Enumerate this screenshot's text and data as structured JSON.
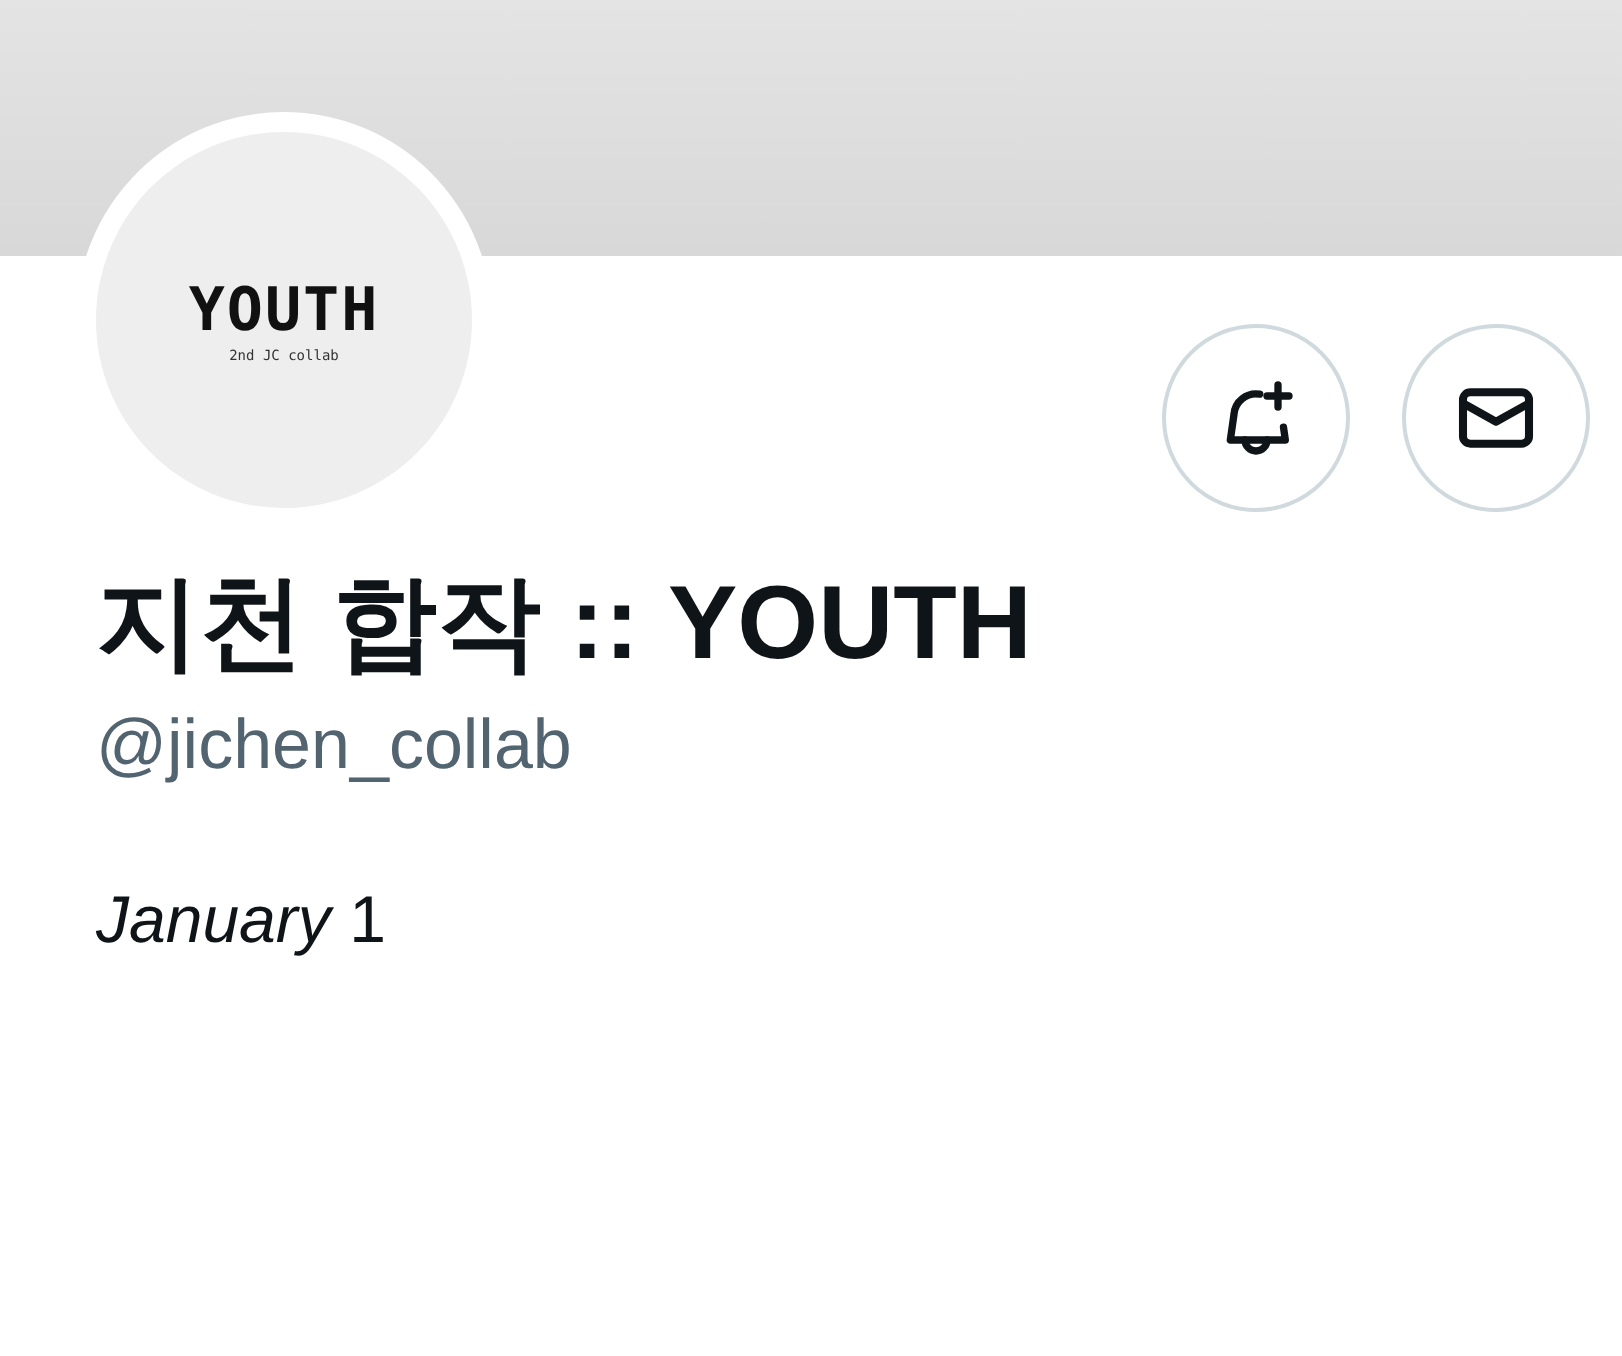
{
  "avatar": {
    "title": "YOUTH",
    "subtitle": "2nd JC collab"
  },
  "display_name": "지천 합작 :: YOUTH",
  "handle": "@jichen_collab",
  "bio": "*January* 1"
}
